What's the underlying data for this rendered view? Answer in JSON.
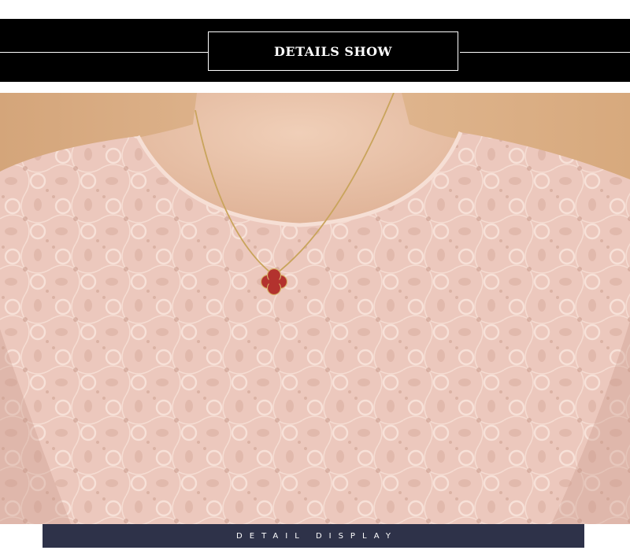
{
  "header": {
    "title": "DETAILS SHOW"
  },
  "photo": {
    "subject": "pink-lace-blouse-with-clover-pendant-necklace"
  },
  "footer": {
    "caption": "DETAIL DISPLAY"
  },
  "colors": {
    "header_bg": "#000000",
    "footer_bg": "#2e3249",
    "lace": "#ecc9bf",
    "skin": "#e8c3aa",
    "pendant": "#b3322e",
    "chain": "#c9a45c"
  }
}
